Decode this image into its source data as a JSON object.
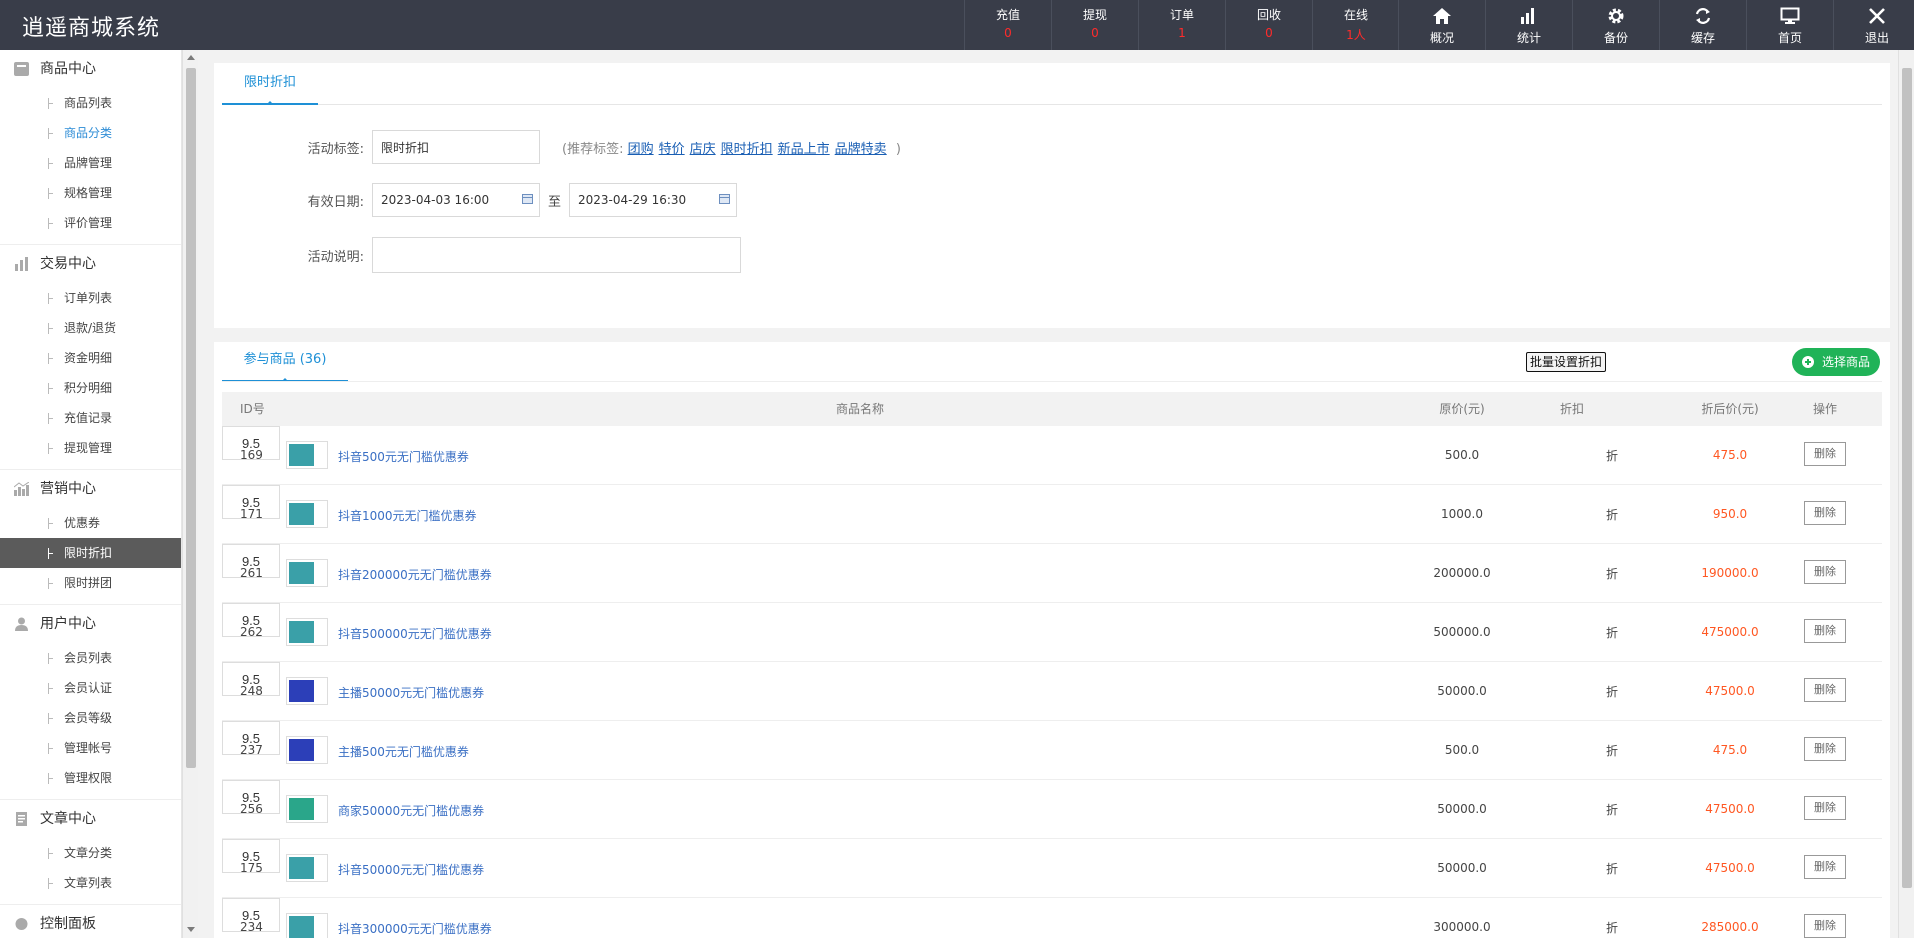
{
  "app": {
    "title": "逍遥商城系统"
  },
  "header": {
    "stats": [
      {
        "label": "充值",
        "value": "0"
      },
      {
        "label": "提现",
        "value": "0"
      },
      {
        "label": "订单",
        "value": "1"
      },
      {
        "label": "回收",
        "value": "0"
      },
      {
        "label": "在线",
        "value": "1人"
      }
    ],
    "tools": [
      {
        "label": "概况",
        "icon": "home-icon"
      },
      {
        "label": "统计",
        "icon": "bar-chart-icon"
      },
      {
        "label": "备份",
        "icon": "gear-icon"
      },
      {
        "label": "缓存",
        "icon": "refresh-icon"
      },
      {
        "label": "首页",
        "icon": "monitor-icon"
      },
      {
        "label": "退出",
        "icon": "close-icon"
      }
    ]
  },
  "sidebar": {
    "groups": [
      {
        "title": "商品中心",
        "icon": "goods-icon",
        "items": [
          "商品列表",
          "商品分类",
          "品牌管理",
          "规格管理",
          "评价管理"
        ]
      },
      {
        "title": "交易中心",
        "icon": "trade-icon",
        "items": [
          "订单列表",
          "退款/退货",
          "资金明细",
          "积分明细",
          "充值记录",
          "提现管理"
        ]
      },
      {
        "title": "营销中心",
        "icon": "marketing-icon",
        "items": [
          "优惠券",
          "限时折扣",
          "限时拼团"
        ]
      },
      {
        "title": "用户中心",
        "icon": "user-icon",
        "items": [
          "会员列表",
          "会员认证",
          "会员等级",
          "管理帐号",
          "管理权限"
        ]
      },
      {
        "title": "文章中心",
        "icon": "article-icon",
        "items": [
          "文章分类",
          "文章列表"
        ]
      },
      {
        "title": "控制面板",
        "icon": "panel-icon",
        "items": []
      }
    ],
    "highlighted_item": "商品分类",
    "active_item": "限时折扣"
  },
  "form": {
    "tab": "限时折扣",
    "tag_label": "活动标签:",
    "tag_value": "限时折扣",
    "recommend_prefix": "(推荐标签:",
    "recommend_tags": [
      "团购",
      "特价",
      "店庆",
      "限时折扣",
      "新品上市",
      "品牌特卖"
    ],
    "recommend_suffix": ")",
    "date_label": "有效日期:",
    "date_start": "2023-04-03 16:00",
    "date_sep": "至",
    "date_end": "2023-04-29 16:30",
    "desc_label": "活动说明:",
    "desc_value": ""
  },
  "goods": {
    "tab": "参与商品 (36)",
    "batch_button": "批量设置折扣",
    "add_button": "选择商品",
    "columns": {
      "id": "ID号",
      "name": "商品名称",
      "price": "原价(元)",
      "discount": "折扣",
      "after": "折后价(元)",
      "op": "操作"
    },
    "zhe": "折",
    "delete_label": "删除",
    "rows": [
      {
        "id": "169",
        "name": "抖音500元无门槛优惠券",
        "price": "500.0",
        "discount": "9.5",
        "after": "475.0",
        "thumb_color": "#3aa0a8"
      },
      {
        "id": "171",
        "name": "抖音1000元无门槛优惠券",
        "price": "1000.0",
        "discount": "9.5",
        "after": "950.0",
        "thumb_color": "#3aa0a8"
      },
      {
        "id": "261",
        "name": "抖音200000元无门槛优惠券",
        "price": "200000.0",
        "discount": "9.5",
        "after": "190000.0",
        "thumb_color": "#3aa0a8"
      },
      {
        "id": "262",
        "name": "抖音500000元无门槛优惠券",
        "price": "500000.0",
        "discount": "9.5",
        "after": "475000.0",
        "thumb_color": "#3aa0a8"
      },
      {
        "id": "248",
        "name": "主播50000元无门槛优惠券",
        "price": "50000.0",
        "discount": "9.5",
        "after": "47500.0",
        "thumb_color": "#2c3fb8"
      },
      {
        "id": "237",
        "name": "主播500元无门槛优惠券",
        "price": "500.0",
        "discount": "9.5",
        "after": "475.0",
        "thumb_color": "#2c3fb8"
      },
      {
        "id": "256",
        "name": "商家50000元无门槛优惠券",
        "price": "50000.0",
        "discount": "9.5",
        "after": "47500.0",
        "thumb_color": "#2aa68a"
      },
      {
        "id": "175",
        "name": "抖音50000元无门槛优惠券",
        "price": "50000.0",
        "discount": "9.5",
        "after": "47500.0",
        "thumb_color": "#3aa0a8"
      },
      {
        "id": "234",
        "name": "抖音300000元无门槛优惠券",
        "price": "300000.0",
        "discount": "9.5",
        "after": "285000.0",
        "thumb_color": "#3aa0a8"
      }
    ]
  }
}
